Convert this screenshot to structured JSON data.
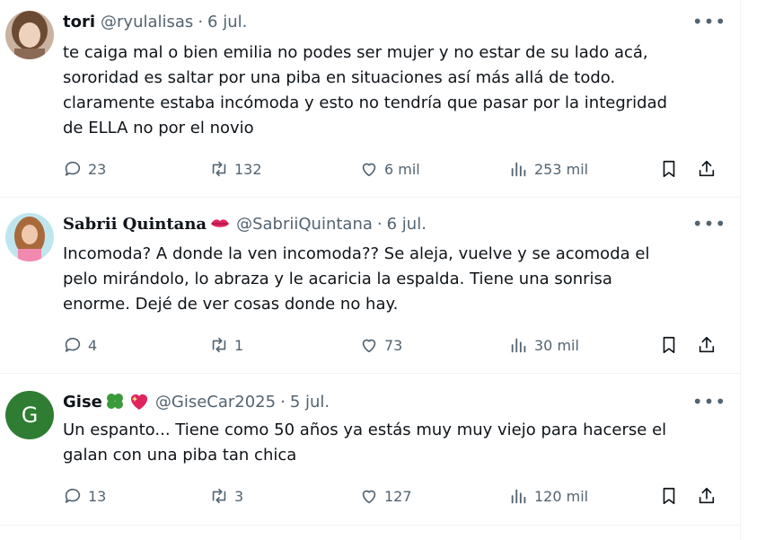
{
  "posts": [
    {
      "name": "tori",
      "handle": "@ryulalisas",
      "date": "6 jul.",
      "text_lines": [
        "te caiga mal o bien emilia no podes ser mujer y no estar de su lado acá,",
        "sororidad es saltar por una piba en situaciones así más allá de todo.",
        "claramente estaba incómoda y esto no tendría que pasar por la integridad",
        "de ELLA no por el novio"
      ],
      "replies": "23",
      "reposts": "132",
      "likes": "6 mil",
      "views": "253 mil"
    },
    {
      "name": "Sabrii Quintana",
      "handle": "@SabriiQuintana",
      "date": "6 jul.",
      "text_lines": [
        "Incomoda? A donde la ven incomoda?? Se aleja, vuelve y se acomoda el",
        "pelo mirándolo, lo abraza y le acaricia la espalda. Tiene una sonrisa",
        "enorme. Dejé de ver cosas  donde no hay."
      ],
      "replies": "4",
      "reposts": "1",
      "likes": "73",
      "views": "30 mil"
    },
    {
      "name": "Gise",
      "handle": "@GiseCar2025",
      "date": "5 jul.",
      "avatar_letter": "G",
      "text_lines": [
        "Un espanto... Tiene como 50 años ya estás muy muy viejo para hacerse el",
        "galan con una piba tan chica"
      ],
      "replies": "13",
      "reposts": "3",
      "likes": "127",
      "views": "120 mil"
    }
  ],
  "ui": {
    "separator": "·",
    "more_glyph": "•••"
  },
  "icons": {
    "reply": "reply-icon",
    "repost": "repost-icon",
    "like": "heart-icon",
    "views": "views-icon",
    "bookmark": "bookmark-icon",
    "share": "share-icon",
    "more": "more-icon",
    "emoji_lips": "kiss-lips-icon",
    "emoji_clover": "clover-icon",
    "emoji_heart": "sparkle-heart-icon"
  },
  "colors": {
    "text": "#0f1419",
    "muted": "#536471",
    "divider": "#eff3f4",
    "avatar_g": "#2e7d32"
  }
}
